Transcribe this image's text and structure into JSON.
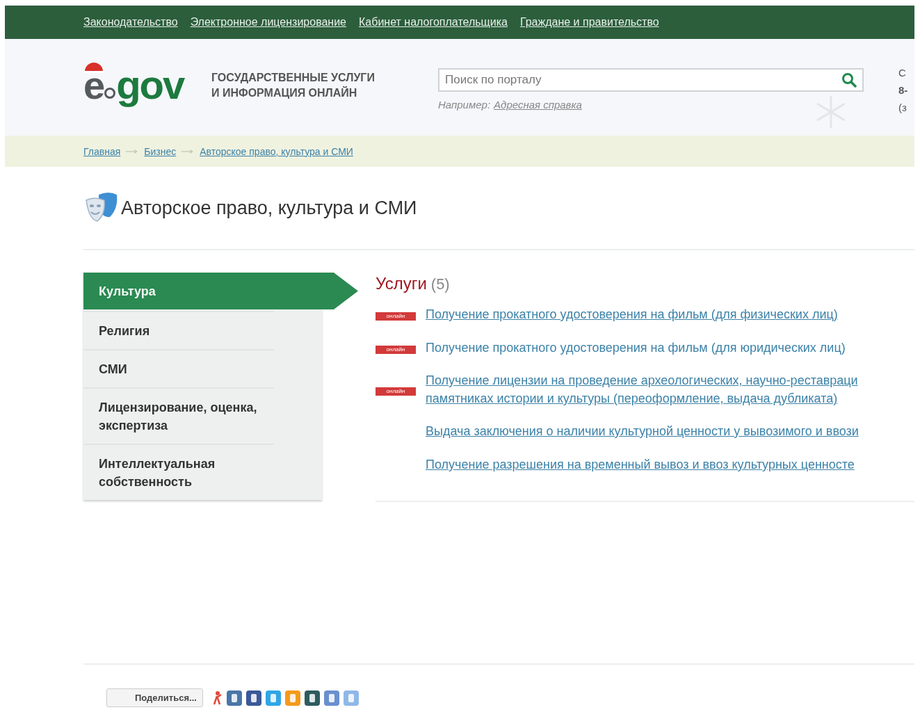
{
  "top_nav": [
    {
      "label": "Законодательство"
    },
    {
      "label": "Электронное лицензирование"
    },
    {
      "label": "Кабинет налогоплательщика"
    },
    {
      "label": "Граждане и правительство"
    }
  ],
  "header": {
    "logo": {
      "e": "e",
      "gov": "gov"
    },
    "tagline": [
      "ГОСУДАРСТВЕННЫЕ УСЛУГИ",
      "И ИНФОРМАЦИЯ ОНЛАЙН"
    ],
    "search": {
      "placeholder": "Поиск по порталу",
      "example_label": "Например:",
      "example_link": "Адресная справка"
    },
    "contact_lines": [
      "С",
      "8-",
      "(з"
    ]
  },
  "breadcrumbs": [
    {
      "label": "Главная"
    },
    {
      "label": "Бизнес"
    },
    {
      "label": "Авторское право, культура и СМИ"
    }
  ],
  "page_title": "Авторское право, культура и СМИ",
  "categories": [
    {
      "label": "Культура",
      "selected": true
    },
    {
      "label": "Религия",
      "selected": false
    },
    {
      "label": "СМИ",
      "selected": false
    },
    {
      "label": "Лицензирование, оценка, экспертиза",
      "selected": false
    },
    {
      "label": "Интеллектуальная собственность",
      "selected": false
    }
  ],
  "services": {
    "title": "Услуги",
    "count": "(5)",
    "items": [
      {
        "lines": [
          "Получение прокатного удостоверения на фильм (для физических лиц)"
        ],
        "badge": "онлайн",
        "underlined": true
      },
      {
        "lines": [
          "Получение прокатного удостоверения на фильм (для юридических лиц)"
        ],
        "badge": "онлайн",
        "underlined": false
      },
      {
        "lines": [
          "Получение лицензии на проведение археологических, научно-реставраци",
          "памятниках истории и культуры (переоформление, выдача дубликата)"
        ],
        "badge": "онлайн",
        "underlined": true
      },
      {
        "lines": [
          "Выдача заключения о наличии культурной ценности у вывозимого и ввози"
        ],
        "underlined": true
      },
      {
        "lines": [
          "Получение разрешения на временный вывоз и ввоз культурных ценносте"
        ],
        "underlined": true
      }
    ]
  },
  "share": {
    "label": "Поделиться..."
  }
}
